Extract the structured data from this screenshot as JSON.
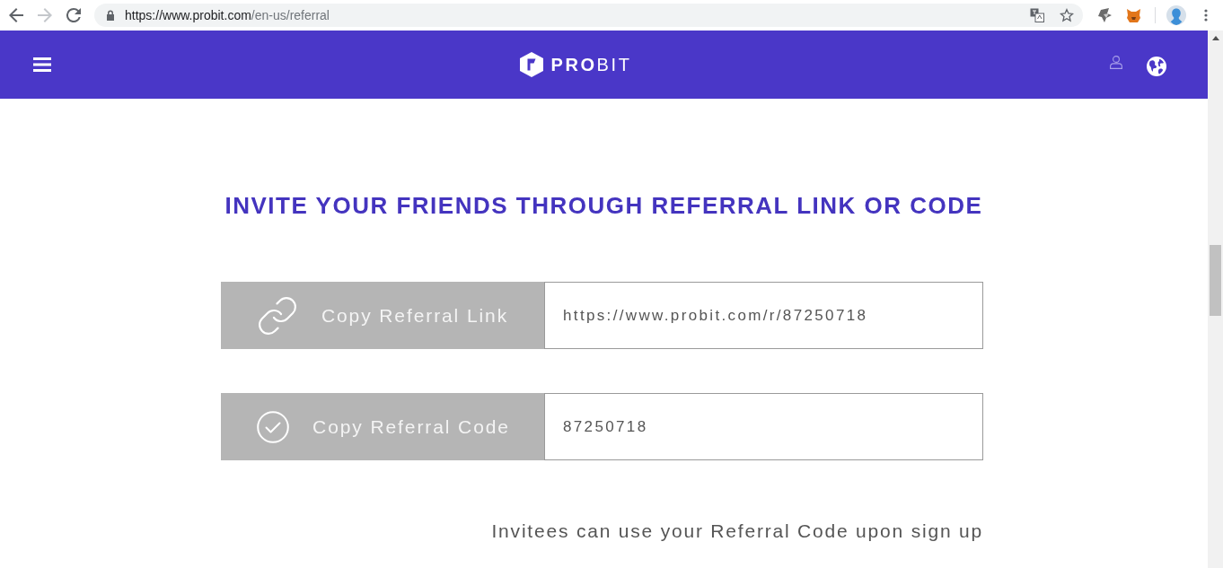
{
  "browser": {
    "forward_disabled": true,
    "address_bar": {
      "origin": "https://www.probit.com",
      "path": "/en-us/referral"
    }
  },
  "header": {
    "logo_text": "**PRO**BIT"
  },
  "heading": "INVITE YOUR FRIENDS THROUGH REFERRAL LINK OR CODE",
  "referral_rows": [
    {
      "kind": "link",
      "button": "Copy Referral Link",
      "value": "https://www.probit.com/r/87250718"
    },
    {
      "kind": "code",
      "button": "Copy Referral Code",
      "value": "87250718"
    }
  ],
  "note": "Invitees can use your Referral Code upon sign up"
}
